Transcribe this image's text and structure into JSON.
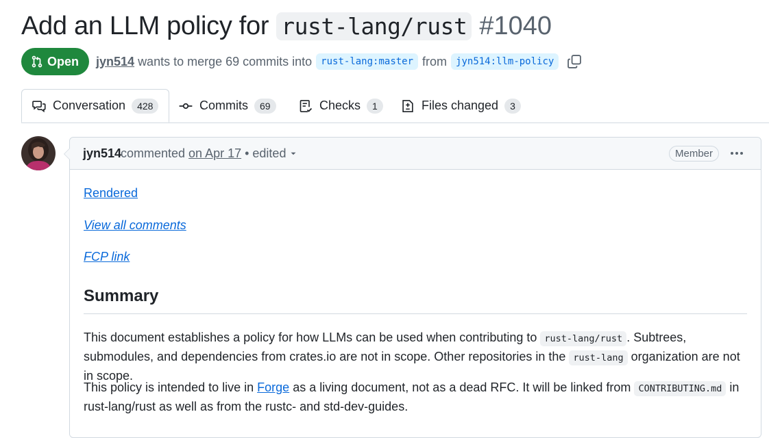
{
  "pr": {
    "title_text": "Add an LLM policy for",
    "title_code": "rust-lang/rust",
    "number": "#1040",
    "status": "Open",
    "author": "jyn514",
    "merge_text": "wants to merge 69 commits into",
    "base_branch": "rust-lang:master",
    "from_text": "from",
    "head_branch": "jyn514:llm-policy"
  },
  "tabs": [
    {
      "label": "Conversation",
      "count": "428",
      "icon": "conversation-icon"
    },
    {
      "label": "Commits",
      "count": "69",
      "icon": "commit-icon"
    },
    {
      "label": "Checks",
      "count": "1",
      "icon": "checks-icon"
    },
    {
      "label": "Files changed",
      "count": "3",
      "icon": "file-diff-icon"
    }
  ],
  "comment": {
    "author": "jyn514",
    "action": "commented",
    "date": "on Apr 17",
    "edited": "• edited",
    "role": "Member",
    "links": [
      "Rendered",
      "View all comments",
      "FCP link"
    ],
    "heading": "Summary",
    "p1": {
      "a": "This document establishes a policy for how LLMs can be used when contributing to",
      "code1": "rust-lang/rust",
      "b": ". Subtrees, submodules, and dependencies from crates.io are not in scope. Other repositories in the",
      "code2": "rust-lang",
      "c": "organization are not in scope."
    },
    "p2": {
      "a": "This policy is intended to live in",
      "link": "Forge",
      "b": "as a living document, not as a dead RFC. It will be linked from",
      "code": "CONTRIBUTING.md",
      "c": "in rust-lang/rust as well as from the rustc- and std-dev-guides."
    }
  },
  "colors": {
    "open_green": "#1f883d",
    "link_blue": "#0969da",
    "branch_bg": "#ddf4ff"
  }
}
